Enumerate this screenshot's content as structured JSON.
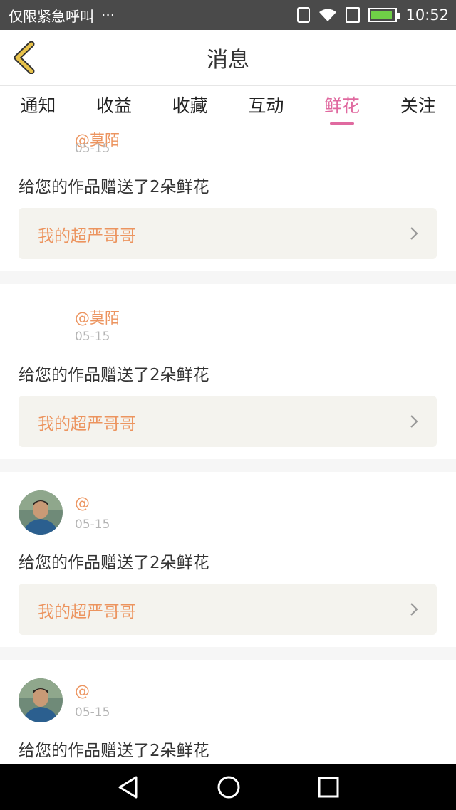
{
  "status": {
    "carrier": "仅限紧急呼叫",
    "dots": "···",
    "time": "10:52",
    "battery_level": 0.9,
    "battery_color": "#6fcf47"
  },
  "header": {
    "title": "消息",
    "back_icon": "chevron-left-icon"
  },
  "tabs": [
    {
      "label": "通知",
      "active": false
    },
    {
      "label": "收益",
      "active": false
    },
    {
      "label": "收藏",
      "active": false
    },
    {
      "label": "互动",
      "active": false
    },
    {
      "label": "鲜花",
      "active": true
    },
    {
      "label": "关注",
      "active": false
    }
  ],
  "items": [
    {
      "username": "@莫陌",
      "date": "05-15",
      "message": "给您的作品赠送了2朵鲜花",
      "work": "我的超严哥哥",
      "has_avatar": false
    },
    {
      "username": "@莫陌",
      "date": "05-15",
      "message": "给您的作品赠送了2朵鲜花",
      "work": "我的超严哥哥",
      "has_avatar": false
    },
    {
      "username": "@",
      "date": "05-15",
      "message": "给您的作品赠送了2朵鲜花",
      "work": "我的超严哥哥",
      "has_avatar": true
    },
    {
      "username": "@",
      "date": "05-15",
      "message": "给您的作品赠送了2朵鲜花",
      "work": "",
      "has_avatar": true
    }
  ],
  "colors": {
    "accent": "#e06aa0",
    "orange": "#ec945f",
    "back_icon": "#e8c24a"
  }
}
